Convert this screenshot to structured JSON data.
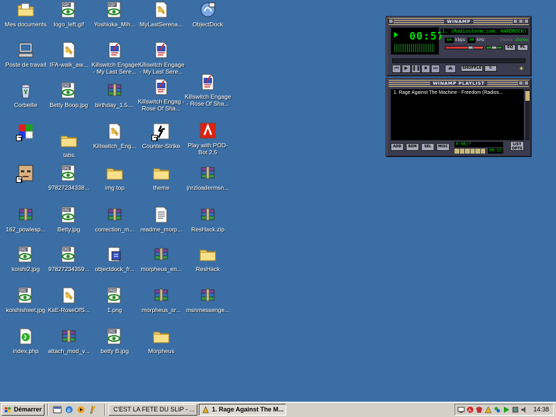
{
  "desktop": {
    "icons": [
      {
        "label": "Mes documents",
        "type": "folder-docs"
      },
      {
        "label": "logo_left.gif",
        "type": "gif"
      },
      {
        "label": "Yoshioka_Mih...",
        "type": "gif"
      },
      {
        "label": "MyLastSerena...",
        "type": "doc"
      },
      {
        "label": "ObjectDock",
        "type": "app-dock"
      },
      {
        "label": "Poste de travail",
        "type": "computer"
      },
      {
        "label": "IFA-walk_aw...",
        "type": "doc"
      },
      {
        "label": "Killswitch Engage - My Last Sere...",
        "type": "media"
      },
      {
        "label": "Killswitch Engage - My Last Sere...",
        "type": "media"
      },
      {
        "label": "Corbeille",
        "type": "recycle"
      },
      {
        "label": "Betty Boop.jpg",
        "type": "jpg"
      },
      {
        "label": "birthday_1.5....",
        "type": "archive"
      },
      {
        "label": "Killswitch Engag - Rose Of Sha...",
        "type": "media"
      },
      {
        "label": "Killswitch Engage - Rose Of Sha...",
        "type": "media"
      },
      {
        "label": "",
        "type": "app-shortcut"
      },
      {
        "label": "tabs",
        "type": "folder"
      },
      {
        "label": "Killswitch_Eng...",
        "type": "doc"
      },
      {
        "label": "Counter-Strike",
        "type": "cs"
      },
      {
        "label": "Play with POD-Bot 2.5",
        "type": "podbot"
      },
      {
        "label": "",
        "type": "face"
      },
      {
        "label": "97827234338...",
        "type": "jpg"
      },
      {
        "label": "img top",
        "type": "folder"
      },
      {
        "label": "theme",
        "type": "folder"
      },
      {
        "label": "jnrzloadermsn...",
        "type": "archive"
      },
      {
        "label": "162_powiesp...",
        "type": "archive"
      },
      {
        "label": "Betty.jpg",
        "type": "jpg"
      },
      {
        "label": "correction_m...",
        "type": "archive"
      },
      {
        "label": "readme_morp...",
        "type": "text"
      },
      {
        "label": "ResHack.zip",
        "type": "archive"
      },
      {
        "label": "koishi2.jpg",
        "type": "jpg"
      },
      {
        "label": "97827234359...",
        "type": "jpg"
      },
      {
        "label": "objectdock_fr...",
        "type": "installer"
      },
      {
        "label": "morpheus_en...",
        "type": "archive"
      },
      {
        "label": "ResHack",
        "type": "folder"
      },
      {
        "label": "koishisheet.jpg",
        "type": "jpg"
      },
      {
        "label": "KsE-RoseOfS...",
        "type": "doc"
      },
      {
        "label": "1.png",
        "type": "png"
      },
      {
        "label": "morpheus_sr...",
        "type": "archive"
      },
      {
        "label": "msnmessenge...",
        "type": "archive"
      },
      {
        "label": "index.php",
        "type": "php"
      },
      {
        "label": "attach_mod_v...",
        "type": "archive"
      },
      {
        "label": "betty B.jpg",
        "type": "jpg"
      },
      {
        "label": "Morpheus",
        "type": "folder"
      }
    ]
  },
  "winamp": {
    "title": "WINAMP",
    "time": "00:57",
    "marquee": "1. (Radiostorm.com: HARDROCK)",
    "kbps": "64",
    "kbps_label": "kbps",
    "khz": "44",
    "khz_label": "kHz",
    "mono_label": "mono",
    "stereo_label": "stereo",
    "volume_level": 0.7,
    "balance_level": 0.5,
    "eq_label": "EQ",
    "pl_label": "PL",
    "shuffle_label": "SHUFFLE",
    "controls": [
      "prev",
      "play",
      "pause",
      "stop",
      "next",
      "eject"
    ],
    "playlist": {
      "title": "WINAMP PLAYLIST",
      "items": [
        "1. Rage Against The Machine - Freedom (Radios..."
      ],
      "buttons": [
        "ADD",
        "REM",
        "SEL",
        "MISC"
      ],
      "list_opts": "LIST OPTS",
      "time_display": "0:00/?",
      "small_time": "00:57"
    }
  },
  "taskbar": {
    "start_label": "Démarrer",
    "tasks": [
      {
        "label": "C'EST LA FETE DU SLIP - ...",
        "active": false
      },
      {
        "label": "1. Rage Against The M...",
        "active": true
      }
    ],
    "clock": "14:38"
  }
}
